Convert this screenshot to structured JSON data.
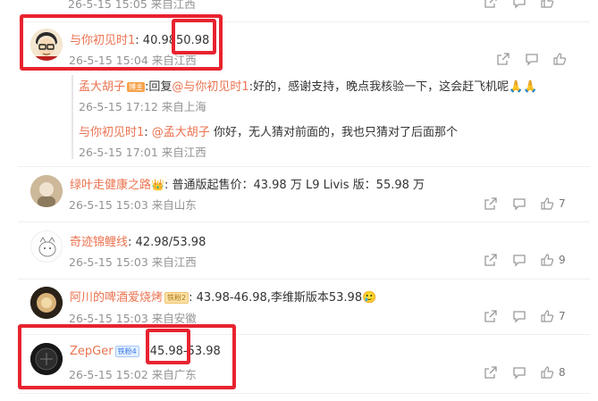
{
  "top": {
    "meta": "26-5-15 15:05 来自江西"
  },
  "comments": [
    {
      "name": "与你初见时1",
      "text": ": 40.98",
      "highlight": "50.98",
      "meta": "26-5-15 15:04 来自江西",
      "replies": [
        {
          "name": "孟大胡子",
          "badge": "博主",
          "text_prefix": ":回复",
          "mention": "@与你初见时1",
          "text": ":好的，感谢支持，晚点我核验一下，这会赶飞机呢🙏🙏",
          "meta": "26-5-15 17:12 来自上海"
        },
        {
          "name": "与你初见时1",
          "text_prefix": ": ",
          "mention": "@孟大胡子",
          "text": " 你好，无人猜对前面的，我也只猜对了后面那个",
          "meta": "26-5-15 17:01 来自江西"
        }
      ]
    },
    {
      "name": "绿叶走健康之路",
      "text": ": 普通版起售价：43.98 万 L9 Livis 版：55.98 万",
      "meta": "26-5-15 15:03 来自山东",
      "likes": "7"
    },
    {
      "name": "奇迹锦鲤线",
      "text": ": 42.98/53.98",
      "meta": "26-5-15 15:03 来自江西",
      "likes": "9"
    },
    {
      "name": "阿川的啤酒爱烧烤",
      "badge": "铁粉2",
      "text": ": 43.98-46.98,李维斯版本53.98🥲",
      "meta": "26-5-15 15:03 来自安徽",
      "likes": "7"
    },
    {
      "name": "ZepGer",
      "badge": "铁粉4",
      "highlight": "45.98-",
      "text_after": "53.98",
      "meta": "26-5-15 15:02 来自广东",
      "likes": "8"
    }
  ],
  "top_likes": "",
  "colors": {
    "accent": "#eb7350",
    "highlight": "#e8232f",
    "meta": "#939393"
  },
  "icons": [
    "share-icon",
    "comment-icon",
    "like-icon"
  ]
}
